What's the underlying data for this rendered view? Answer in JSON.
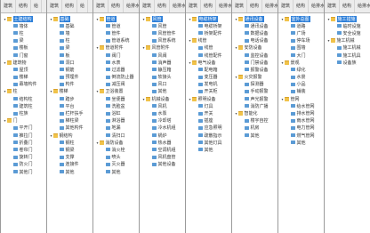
{
  "panels": [
    {
      "tabs": [
        "建筑",
        "结构",
        "给"
      ],
      "items": [
        {
          "level": 0,
          "type": "folder",
          "label": "土建结构",
          "expanded": true,
          "selected": true
        },
        {
          "level": 1,
          "type": "item",
          "label": "墙体"
        },
        {
          "level": 1,
          "type": "item",
          "label": "柱"
        },
        {
          "level": 1,
          "type": "item",
          "label": "梁"
        },
        {
          "level": 1,
          "type": "item",
          "label": "楼板"
        },
        {
          "level": 1,
          "type": "item",
          "label": "门窗"
        },
        {
          "level": 0,
          "type": "folder",
          "label": "建筑物",
          "expanded": true
        },
        {
          "level": 1,
          "type": "item",
          "label": "屋顶"
        },
        {
          "level": 1,
          "type": "item",
          "label": "楼梯"
        },
        {
          "level": 1,
          "type": "item",
          "label": "幕墙构件"
        },
        {
          "level": 0,
          "type": "folder",
          "label": "柱",
          "expanded": true
        },
        {
          "level": 1,
          "type": "item",
          "label": "结构柱"
        },
        {
          "level": 1,
          "type": "item",
          "label": "建筑柱"
        },
        {
          "level": 1,
          "type": "item",
          "label": "柱族"
        },
        {
          "level": 0,
          "type": "folder",
          "label": "门",
          "expanded": true
        },
        {
          "level": 1,
          "type": "item",
          "label": "平开门"
        },
        {
          "level": 1,
          "type": "item",
          "label": "推拉门"
        },
        {
          "level": 1,
          "type": "item",
          "label": "折叠门"
        },
        {
          "level": 1,
          "type": "item",
          "label": "卷帘门"
        },
        {
          "level": 1,
          "type": "item",
          "label": "旋转门"
        },
        {
          "level": 1,
          "type": "item",
          "label": "防火门"
        },
        {
          "level": 1,
          "type": "item",
          "label": "其他门"
        }
      ]
    },
    {
      "tabs": [
        "建筑",
        "结构",
        "给"
      ],
      "items": [
        {
          "level": 0,
          "type": "folder",
          "label": "基础",
          "expanded": true,
          "selected": true
        },
        {
          "level": 1,
          "type": "item",
          "label": "基础"
        },
        {
          "level": 1,
          "type": "item",
          "label": "墙"
        },
        {
          "level": 1,
          "type": "item",
          "label": "柱"
        },
        {
          "level": 1,
          "type": "item",
          "label": "梁"
        },
        {
          "level": 1,
          "type": "item",
          "label": "板"
        },
        {
          "level": 1,
          "type": "item",
          "label": "洞口"
        },
        {
          "level": 1,
          "type": "item",
          "label": "钢筋"
        },
        {
          "level": 1,
          "type": "item",
          "label": "预埋件"
        },
        {
          "level": 1,
          "type": "item",
          "label": "构件"
        },
        {
          "level": 0,
          "type": "folder",
          "label": "楼梯",
          "expanded": true
        },
        {
          "level": 1,
          "type": "item",
          "label": "踏步"
        },
        {
          "level": 1,
          "type": "item",
          "label": "平台"
        },
        {
          "level": 1,
          "type": "item",
          "label": "栏杆扶手"
        },
        {
          "level": 1,
          "type": "item",
          "label": "梯柱梁"
        },
        {
          "level": 1,
          "type": "item",
          "label": "其他构件"
        },
        {
          "level": 0,
          "type": "folder",
          "label": "钢结构",
          "expanded": true
        },
        {
          "level": 1,
          "type": "item",
          "label": "钢柱"
        },
        {
          "level": 1,
          "type": "item",
          "label": "钢梁"
        },
        {
          "level": 1,
          "type": "item",
          "label": "支撑"
        },
        {
          "level": 1,
          "type": "item",
          "label": "连接件"
        },
        {
          "level": 1,
          "type": "item",
          "label": "其他"
        }
      ]
    },
    {
      "tabs": [
        "建筑",
        "结构",
        "给排水"
      ],
      "items": [
        {
          "level": 0,
          "type": "folder",
          "label": "管道",
          "expanded": true,
          "selected": true
        },
        {
          "level": 1,
          "type": "item",
          "label": "管道"
        },
        {
          "level": 1,
          "type": "item",
          "label": "管件"
        },
        {
          "level": 1,
          "type": "item",
          "label": "管道系统"
        },
        {
          "level": 0,
          "type": "folder",
          "label": "管道附件",
          "expanded": true
        },
        {
          "level": 1,
          "type": "item",
          "label": "阀门"
        },
        {
          "level": 1,
          "type": "item",
          "label": "水表"
        },
        {
          "level": 1,
          "type": "item",
          "label": "过滤器"
        },
        {
          "level": 1,
          "type": "item",
          "label": "倒流防止器"
        },
        {
          "level": 1,
          "type": "item",
          "label": "减压阀"
        },
        {
          "level": 0,
          "type": "folder",
          "label": "卫浴装置",
          "expanded": true
        },
        {
          "level": 1,
          "type": "item",
          "label": "坐便器"
        },
        {
          "level": 1,
          "type": "item",
          "label": "洗脸盆"
        },
        {
          "level": 1,
          "type": "item",
          "label": "浴缸"
        },
        {
          "level": 1,
          "type": "item",
          "label": "淋浴器"
        },
        {
          "level": 1,
          "type": "item",
          "label": "地漏"
        },
        {
          "level": 1,
          "type": "item",
          "label": "清扫口"
        },
        {
          "level": 0,
          "type": "folder",
          "label": "消防设备",
          "expanded": true
        },
        {
          "level": 1,
          "type": "item",
          "label": "消火栓"
        },
        {
          "level": 1,
          "type": "item",
          "label": "喷头"
        },
        {
          "level": 1,
          "type": "item",
          "label": "灭火器"
        },
        {
          "level": 1,
          "type": "item",
          "label": "其他"
        }
      ]
    },
    {
      "tabs": [
        "建筑",
        "结构",
        "给排水"
      ],
      "items": [
        {
          "level": 0,
          "type": "folder",
          "label": "风管",
          "expanded": true,
          "selected": true
        },
        {
          "level": 1,
          "type": "item",
          "label": "风管"
        },
        {
          "level": 1,
          "type": "item",
          "label": "风管管件"
        },
        {
          "level": 1,
          "type": "item",
          "label": "风管系统"
        },
        {
          "level": 0,
          "type": "folder",
          "label": "风管附件",
          "expanded": true
        },
        {
          "level": 1,
          "type": "item",
          "label": "风阀"
        },
        {
          "level": 1,
          "type": "item",
          "label": "消声器"
        },
        {
          "level": 1,
          "type": "item",
          "label": "静压箱"
        },
        {
          "level": 1,
          "type": "item",
          "label": "软接头"
        },
        {
          "level": 1,
          "type": "item",
          "label": "风口"
        },
        {
          "level": 1,
          "type": "item",
          "label": "其他"
        },
        {
          "level": 0,
          "type": "folder",
          "label": "机械设备",
          "expanded": true
        },
        {
          "level": 1,
          "type": "item",
          "label": "风机"
        },
        {
          "level": 1,
          "type": "item",
          "label": "水泵"
        },
        {
          "level": 1,
          "type": "item",
          "label": "冷却塔"
        },
        {
          "level": 1,
          "type": "item",
          "label": "冷水机组"
        },
        {
          "level": 1,
          "type": "item",
          "label": "锅炉"
        },
        {
          "level": 1,
          "type": "item",
          "label": "热水器"
        },
        {
          "level": 1,
          "type": "item",
          "label": "空调机组"
        },
        {
          "level": 1,
          "type": "item",
          "label": "风机盘管"
        },
        {
          "level": 1,
          "type": "item",
          "label": "其他设备"
        }
      ]
    },
    {
      "tabs": [
        "建筑",
        "结构",
        "给排水"
      ],
      "items": [
        {
          "level": 0,
          "type": "folder",
          "label": "电缆桥架",
          "expanded": true,
          "selected": true
        },
        {
          "level": 1,
          "type": "item",
          "label": "电缆桥架"
        },
        {
          "level": 1,
          "type": "item",
          "label": "桥架配件"
        },
        {
          "level": 0,
          "type": "folder",
          "label": "线管",
          "expanded": true
        },
        {
          "level": 1,
          "type": "item",
          "label": "线管"
        },
        {
          "level": 1,
          "type": "item",
          "label": "线管配件"
        },
        {
          "level": 0,
          "type": "folder",
          "label": "电气设备",
          "expanded": true
        },
        {
          "level": 1,
          "type": "item",
          "label": "配电箱"
        },
        {
          "level": 1,
          "type": "item",
          "label": "变压器"
        },
        {
          "level": 1,
          "type": "item",
          "label": "发电机"
        },
        {
          "level": 1,
          "type": "item",
          "label": "开关柜"
        },
        {
          "level": 0,
          "type": "folder",
          "label": "照明设备",
          "expanded": true
        },
        {
          "level": 1,
          "type": "item",
          "label": "灯具"
        },
        {
          "level": 1,
          "type": "item",
          "label": "开关"
        },
        {
          "level": 1,
          "type": "item",
          "label": "插座"
        },
        {
          "level": 1,
          "type": "item",
          "label": "应急照明"
        },
        {
          "level": 1,
          "type": "item",
          "label": "疏散指示"
        },
        {
          "level": 1,
          "type": "item",
          "label": "其他灯具"
        },
        {
          "level": 1,
          "type": "item",
          "label": "其他"
        }
      ]
    },
    {
      "tabs": [
        "建筑",
        "结构",
        "给排水"
      ],
      "items": [
        {
          "level": 0,
          "type": "folder",
          "label": "通讯设备",
          "expanded": true,
          "selected": true
        },
        {
          "level": 1,
          "type": "item",
          "label": "通讯设备"
        },
        {
          "level": 1,
          "type": "item",
          "label": "数据设备"
        },
        {
          "level": 1,
          "type": "item",
          "label": "电话设备"
        },
        {
          "level": 0,
          "type": "folder",
          "label": "安防设备",
          "expanded": true
        },
        {
          "level": 1,
          "type": "item",
          "label": "监控设备"
        },
        {
          "level": 1,
          "type": "item",
          "label": "门禁设备"
        },
        {
          "level": 1,
          "type": "item",
          "label": "报警设备"
        },
        {
          "level": 0,
          "type": "folder",
          "label": "火灾报警",
          "expanded": true
        },
        {
          "level": 1,
          "type": "item",
          "label": "探测器"
        },
        {
          "level": 1,
          "type": "item",
          "label": "手动报警"
        },
        {
          "level": 1,
          "type": "item",
          "label": "声光报警"
        },
        {
          "level": 1,
          "type": "item",
          "label": "消防广播"
        },
        {
          "level": 0,
          "type": "folder",
          "label": "智能化",
          "expanded": true
        },
        {
          "level": 1,
          "type": "item",
          "label": "楼宇自控"
        },
        {
          "level": 1,
          "type": "item",
          "label": "机房"
        },
        {
          "level": 1,
          "type": "item",
          "label": "其他"
        }
      ]
    },
    {
      "tabs": [
        "建筑",
        "结构",
        "给排水"
      ],
      "items": [
        {
          "level": 0,
          "type": "folder",
          "label": "室外总图",
          "expanded": true,
          "selected": true
        },
        {
          "level": 1,
          "type": "item",
          "label": "道路"
        },
        {
          "level": 1,
          "type": "item",
          "label": "广场"
        },
        {
          "level": 1,
          "type": "item",
          "label": "停车场"
        },
        {
          "level": 1,
          "type": "item",
          "label": "围墙"
        },
        {
          "level": 1,
          "type": "item",
          "label": "大门"
        },
        {
          "level": 0,
          "type": "folder",
          "label": "景观",
          "expanded": true
        },
        {
          "level": 1,
          "type": "item",
          "label": "绿化"
        },
        {
          "level": 1,
          "type": "item",
          "label": "水景"
        },
        {
          "level": 1,
          "type": "item",
          "label": "小品"
        },
        {
          "level": 1,
          "type": "item",
          "label": "铺装"
        },
        {
          "level": 0,
          "type": "folder",
          "label": "管网",
          "expanded": true
        },
        {
          "level": 1,
          "type": "item",
          "label": "给水管网"
        },
        {
          "level": 1,
          "type": "item",
          "label": "排水管网"
        },
        {
          "level": 1,
          "type": "item",
          "label": "雨水管网"
        },
        {
          "level": 1,
          "type": "item",
          "label": "电力管网"
        },
        {
          "level": 1,
          "type": "item",
          "label": "燃气管网"
        },
        {
          "level": 1,
          "type": "item",
          "label": "其他"
        }
      ]
    },
    {
      "tabs": [
        "建筑",
        "结构",
        "给排水"
      ],
      "items": [
        {
          "level": 0,
          "type": "folder",
          "label": "施工措施",
          "expanded": true,
          "selected": true
        },
        {
          "level": 1,
          "type": "item",
          "label": "临时设施"
        },
        {
          "level": 1,
          "type": "item",
          "label": "安全设施"
        },
        {
          "level": 0,
          "type": "folder",
          "label": "施工机械",
          "expanded": true
        },
        {
          "level": 1,
          "type": "item",
          "label": "施工机械"
        },
        {
          "level": 1,
          "type": "item",
          "label": "施工机具"
        },
        {
          "level": 1,
          "type": "item",
          "label": "设备族"
        }
      ]
    }
  ]
}
